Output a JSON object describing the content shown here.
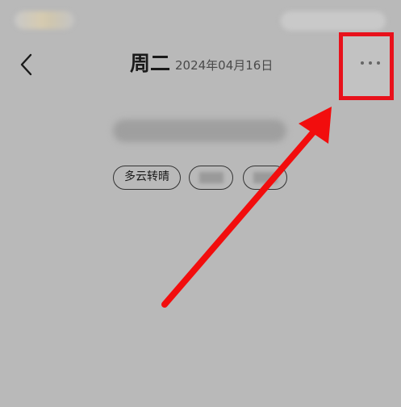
{
  "header": {
    "title": "周二",
    "date": "2024年04月16日"
  },
  "tags": [
    {
      "label": "多云转晴"
    },
    {
      "label": ""
    },
    {
      "label": ""
    }
  ],
  "icons": {
    "back": "chevron-left-icon",
    "more": "more-horizontal-icon"
  },
  "annotation": {
    "highlight_color": "#e8111b"
  }
}
